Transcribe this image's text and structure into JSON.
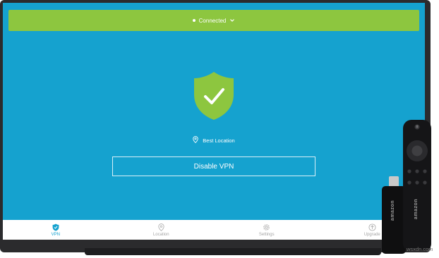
{
  "status": {
    "label": "Connected",
    "color": "#8dc63f"
  },
  "main": {
    "shield_icon": "shield-check-icon",
    "location_icon": "map-pin-icon",
    "location_label": "Best Location",
    "disable_button_label": "Disable VPN",
    "background_color": "#15a2cf"
  },
  "nav": {
    "items": [
      {
        "label": "VPN",
        "icon": "shield-icon",
        "active": true
      },
      {
        "label": "Location",
        "icon": "map-pin-icon",
        "active": false
      },
      {
        "label": "Settings",
        "icon": "gear-icon",
        "active": false
      },
      {
        "label": "Upgrade",
        "icon": "upgrade-icon",
        "active": false
      }
    ]
  },
  "devices": {
    "remote_brand": "amazon",
    "stick_brand": "amazon"
  },
  "watermark": "wsxdn.com"
}
